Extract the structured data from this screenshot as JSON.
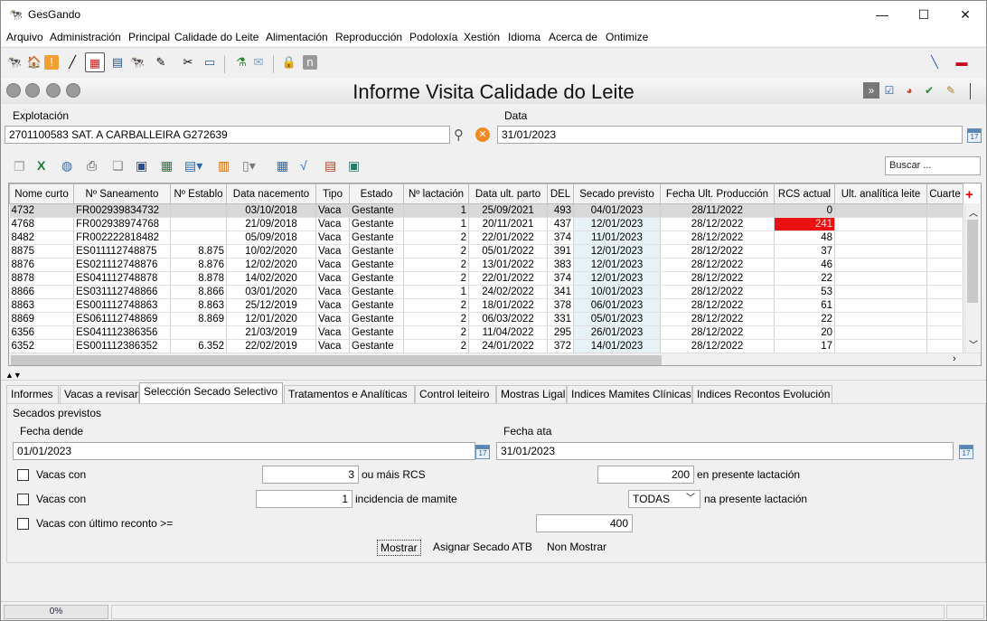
{
  "window": {
    "title": "GesGando"
  },
  "menu": [
    "Arquivo",
    "Administración",
    "Principal",
    "Calidade do Leite",
    "Alimentación",
    "Reproducción",
    "Podoloxía",
    "Xestión",
    "Idioma",
    "Acerca de",
    "Ontimize"
  ],
  "page": {
    "title": "Informe Visita Calidade do Leite"
  },
  "filters": {
    "explotacion_label": "Explotación",
    "explotacion_value": "2701100583 SAT. A CARBALLEIRA G272639",
    "data_label": "Data",
    "data_value": "31/01/2023",
    "search_placeholder": "Buscar ..."
  },
  "grid": {
    "columns": [
      "Nome curto",
      "Nº Saneamento",
      "Nº Establo",
      "Data nacemento",
      "Tipo",
      "Estado",
      "Nº lactación",
      "Data ult. parto",
      "DEL",
      "Secado previsto",
      "Fecha Ult. Producción",
      "RCS actual",
      "Ult. analítica leite",
      "Cuarte"
    ],
    "rows": [
      [
        "4732",
        "FR002939834732",
        "",
        "03/10/2018",
        "Vaca",
        "Gestante",
        "1",
        "25/09/2021",
        "493",
        "04/01/2023",
        "28/11/2022",
        "0",
        ""
      ],
      [
        "4768",
        "FR002938974768",
        "",
        "21/09/2018",
        "Vaca",
        "Gestante",
        "1",
        "20/11/2021",
        "437",
        "12/01/2023",
        "28/12/2022",
        "241",
        ""
      ],
      [
        "8482",
        "FR002222818482",
        "",
        "05/09/2018",
        "Vaca",
        "Gestante",
        "2",
        "22/01/2022",
        "374",
        "11/01/2023",
        "28/12/2022",
        "48",
        ""
      ],
      [
        "8875",
        "ES011112748875",
        "8.875",
        "10/02/2020",
        "Vaca",
        "Gestante",
        "2",
        "05/01/2022",
        "391",
        "12/01/2023",
        "28/12/2022",
        "37",
        ""
      ],
      [
        "8876",
        "ES021112748876",
        "8.876",
        "12/02/2020",
        "Vaca",
        "Gestante",
        "2",
        "13/01/2022",
        "383",
        "12/01/2023",
        "28/12/2022",
        "46",
        ""
      ],
      [
        "8878",
        "ES041112748878",
        "8.878",
        "14/02/2020",
        "Vaca",
        "Gestante",
        "2",
        "22/01/2022",
        "374",
        "12/01/2023",
        "28/12/2022",
        "22",
        ""
      ],
      [
        "8866",
        "ES031112748866",
        "8.866",
        "03/01/2020",
        "Vaca",
        "Gestante",
        "1",
        "24/02/2022",
        "341",
        "10/01/2023",
        "28/12/2022",
        "53",
        ""
      ],
      [
        "8863",
        "ES001112748863",
        "8.863",
        "25/12/2019",
        "Vaca",
        "Gestante",
        "2",
        "18/01/2022",
        "378",
        "06/01/2023",
        "28/12/2022",
        "61",
        ""
      ],
      [
        "8869",
        "ES061112748869",
        "8.869",
        "12/01/2020",
        "Vaca",
        "Gestante",
        "2",
        "06/03/2022",
        "331",
        "05/01/2023",
        "28/12/2022",
        "22",
        ""
      ],
      [
        "6356",
        "ES041112386356",
        "",
        "21/03/2019",
        "Vaca",
        "Gestante",
        "2",
        "11/04/2022",
        "295",
        "26/01/2023",
        "28/12/2022",
        "20",
        ""
      ],
      [
        "6352",
        "ES001112386352",
        "6.352",
        "22/02/2019",
        "Vaca",
        "Gestante",
        "2",
        "24/01/2022",
        "372",
        "14/01/2023",
        "28/12/2022",
        "17",
        ""
      ]
    ]
  },
  "tabs": [
    "Informes",
    "Vacas a revisar",
    "Selección Secado Selectivo",
    "Tratamentos e Analíticas",
    "Control leiteiro",
    "Mostras Ligal",
    "Indices Mamites Clínicas",
    "Indices Recontos Evolución"
  ],
  "panel": {
    "group_label": "Secados previstos",
    "fecha_dende_label": "Fecha dende",
    "fecha_dende_value": "01/01/2023",
    "fecha_ata_label": "Fecha ata",
    "fecha_ata_value": "31/01/2023",
    "row1_label": "Vacas con",
    "row1_value": "3",
    "row1_mid": "ou máis RCS",
    "row1_value2": "200",
    "row1_end": "en presente lactación",
    "row2_label": "Vacas con",
    "row2_value": "1",
    "row2_mid": "incidencia de mamite",
    "row2_select": "TODAS",
    "row2_end": "na presente lactación",
    "row3_label": "Vacas con último reconto >=",
    "row3_value": "400",
    "btn_mostrar": "Mostrar",
    "btn_asignar": "Asignar Secado ATB",
    "btn_non_mostrar": "Non Mostrar"
  },
  "status": {
    "progress_text": "0%"
  },
  "colors": {
    "hot_cell": "#ee1111",
    "secado_bg": "#e6f2f6",
    "selected_row": "#d9d9d9"
  }
}
